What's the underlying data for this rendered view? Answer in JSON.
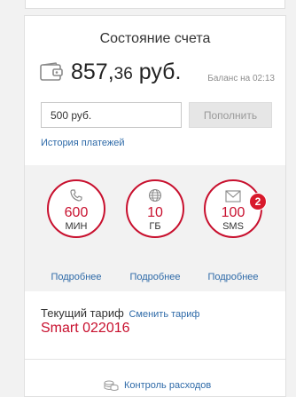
{
  "account": {
    "title": "Состояние счета",
    "balance_main": "857,",
    "balance_fraction": "36",
    "balance_currency": " руб.",
    "balance_time": "Баланс на 02:13"
  },
  "topup": {
    "input_value": "500 руб.",
    "button_label": "Пополнить",
    "history_link": "История платежей"
  },
  "remains": [
    {
      "value": "600",
      "unit": "МИН",
      "icon": "phone-icon",
      "more": "Подробнее"
    },
    {
      "value": "10",
      "unit": "ГБ",
      "icon": "globe-icon",
      "more": "Подробнее"
    },
    {
      "value": "100",
      "unit": "SMS",
      "icon": "envelope-icon",
      "more": "Подробнее"
    }
  ],
  "sms_badge": "2",
  "tariff": {
    "label": "Текущий тариф",
    "change_link": "Сменить тариф",
    "name": "Smart 022016"
  },
  "expense_control": {
    "label": "Контроль расходов",
    "icon": "coins-icon"
  },
  "colors": {
    "accent_red": "#c8102e",
    "link_blue": "#2e6aa8",
    "band_gray": "#f2f2f2"
  }
}
